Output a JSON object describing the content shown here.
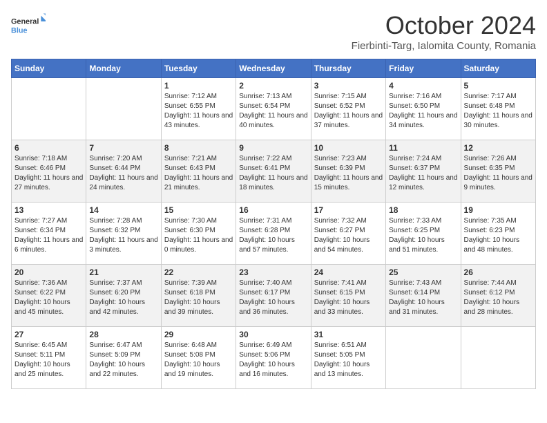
{
  "header": {
    "logo_general": "General",
    "logo_blue": "Blue",
    "month": "October 2024",
    "location": "Fierbinti-Targ, Ialomita County, Romania"
  },
  "days_of_week": [
    "Sunday",
    "Monday",
    "Tuesday",
    "Wednesday",
    "Thursday",
    "Friday",
    "Saturday"
  ],
  "weeks": [
    [
      {
        "day": "",
        "info": ""
      },
      {
        "day": "",
        "info": ""
      },
      {
        "day": "1",
        "info": "Sunrise: 7:12 AM\nSunset: 6:55 PM\nDaylight: 11 hours and 43 minutes."
      },
      {
        "day": "2",
        "info": "Sunrise: 7:13 AM\nSunset: 6:54 PM\nDaylight: 11 hours and 40 minutes."
      },
      {
        "day": "3",
        "info": "Sunrise: 7:15 AM\nSunset: 6:52 PM\nDaylight: 11 hours and 37 minutes."
      },
      {
        "day": "4",
        "info": "Sunrise: 7:16 AM\nSunset: 6:50 PM\nDaylight: 11 hours and 34 minutes."
      },
      {
        "day": "5",
        "info": "Sunrise: 7:17 AM\nSunset: 6:48 PM\nDaylight: 11 hours and 30 minutes."
      }
    ],
    [
      {
        "day": "6",
        "info": "Sunrise: 7:18 AM\nSunset: 6:46 PM\nDaylight: 11 hours and 27 minutes."
      },
      {
        "day": "7",
        "info": "Sunrise: 7:20 AM\nSunset: 6:44 PM\nDaylight: 11 hours and 24 minutes."
      },
      {
        "day": "8",
        "info": "Sunrise: 7:21 AM\nSunset: 6:43 PM\nDaylight: 11 hours and 21 minutes."
      },
      {
        "day": "9",
        "info": "Sunrise: 7:22 AM\nSunset: 6:41 PM\nDaylight: 11 hours and 18 minutes."
      },
      {
        "day": "10",
        "info": "Sunrise: 7:23 AM\nSunset: 6:39 PM\nDaylight: 11 hours and 15 minutes."
      },
      {
        "day": "11",
        "info": "Sunrise: 7:24 AM\nSunset: 6:37 PM\nDaylight: 11 hours and 12 minutes."
      },
      {
        "day": "12",
        "info": "Sunrise: 7:26 AM\nSunset: 6:35 PM\nDaylight: 11 hours and 9 minutes."
      }
    ],
    [
      {
        "day": "13",
        "info": "Sunrise: 7:27 AM\nSunset: 6:34 PM\nDaylight: 11 hours and 6 minutes."
      },
      {
        "day": "14",
        "info": "Sunrise: 7:28 AM\nSunset: 6:32 PM\nDaylight: 11 hours and 3 minutes."
      },
      {
        "day": "15",
        "info": "Sunrise: 7:30 AM\nSunset: 6:30 PM\nDaylight: 11 hours and 0 minutes."
      },
      {
        "day": "16",
        "info": "Sunrise: 7:31 AM\nSunset: 6:28 PM\nDaylight: 10 hours and 57 minutes."
      },
      {
        "day": "17",
        "info": "Sunrise: 7:32 AM\nSunset: 6:27 PM\nDaylight: 10 hours and 54 minutes."
      },
      {
        "day": "18",
        "info": "Sunrise: 7:33 AM\nSunset: 6:25 PM\nDaylight: 10 hours and 51 minutes."
      },
      {
        "day": "19",
        "info": "Sunrise: 7:35 AM\nSunset: 6:23 PM\nDaylight: 10 hours and 48 minutes."
      }
    ],
    [
      {
        "day": "20",
        "info": "Sunrise: 7:36 AM\nSunset: 6:22 PM\nDaylight: 10 hours and 45 minutes."
      },
      {
        "day": "21",
        "info": "Sunrise: 7:37 AM\nSunset: 6:20 PM\nDaylight: 10 hours and 42 minutes."
      },
      {
        "day": "22",
        "info": "Sunrise: 7:39 AM\nSunset: 6:18 PM\nDaylight: 10 hours and 39 minutes."
      },
      {
        "day": "23",
        "info": "Sunrise: 7:40 AM\nSunset: 6:17 PM\nDaylight: 10 hours and 36 minutes."
      },
      {
        "day": "24",
        "info": "Sunrise: 7:41 AM\nSunset: 6:15 PM\nDaylight: 10 hours and 33 minutes."
      },
      {
        "day": "25",
        "info": "Sunrise: 7:43 AM\nSunset: 6:14 PM\nDaylight: 10 hours and 31 minutes."
      },
      {
        "day": "26",
        "info": "Sunrise: 7:44 AM\nSunset: 6:12 PM\nDaylight: 10 hours and 28 minutes."
      }
    ],
    [
      {
        "day": "27",
        "info": "Sunrise: 6:45 AM\nSunset: 5:11 PM\nDaylight: 10 hours and 25 minutes."
      },
      {
        "day": "28",
        "info": "Sunrise: 6:47 AM\nSunset: 5:09 PM\nDaylight: 10 hours and 22 minutes."
      },
      {
        "day": "29",
        "info": "Sunrise: 6:48 AM\nSunset: 5:08 PM\nDaylight: 10 hours and 19 minutes."
      },
      {
        "day": "30",
        "info": "Sunrise: 6:49 AM\nSunset: 5:06 PM\nDaylight: 10 hours and 16 minutes."
      },
      {
        "day": "31",
        "info": "Sunrise: 6:51 AM\nSunset: 5:05 PM\nDaylight: 10 hours and 13 minutes."
      },
      {
        "day": "",
        "info": ""
      },
      {
        "day": "",
        "info": ""
      }
    ]
  ]
}
